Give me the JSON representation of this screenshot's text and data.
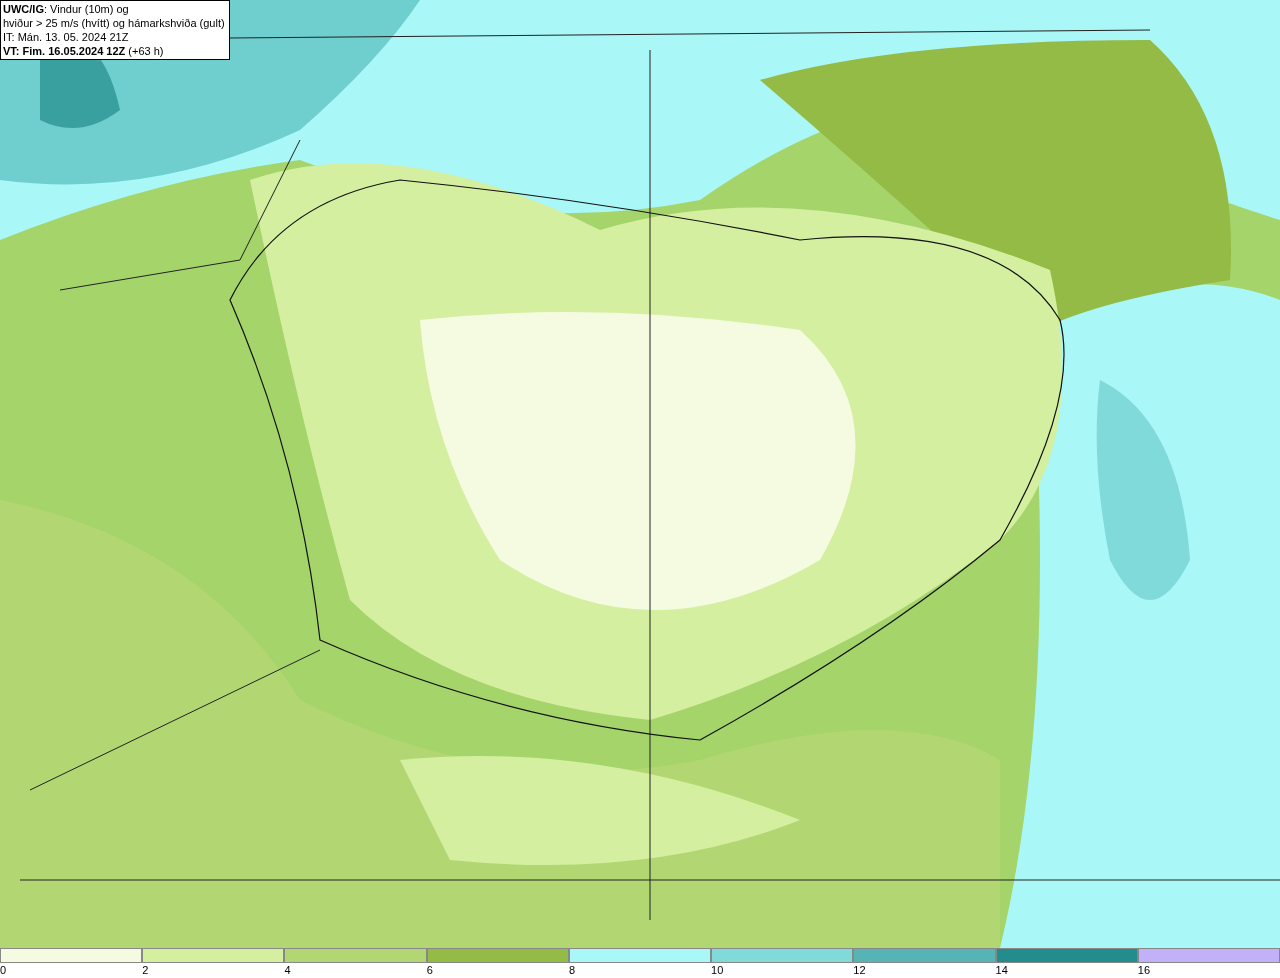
{
  "info_box": {
    "lines": [
      "**UWC/IG**: Vindur (10m) og",
      "hviður > 25 m/s (hvítt) og hámarkshviða (gult)",
      "IT: Mán. 13. 05. 2024 21Z",
      "**VT: Fim. 16.05.2024 12Z** (+63 h)"
    ]
  },
  "legend": {
    "bins": [
      {
        "label": "0",
        "color": "#f5fbe0"
      },
      {
        "label": "2",
        "color": "#d4ef9f"
      },
      {
        "label": "4",
        "color": "#b2d772"
      },
      {
        "label": "6",
        "color": "#93bb45"
      },
      {
        "label": "8",
        "color": "#aaf7f7"
      },
      {
        "label": "10",
        "color": "#80dada"
      },
      {
        "label": "12",
        "color": "#56b4b4"
      },
      {
        "label": "14",
        "color": "#238c8c"
      },
      {
        "label": "16",
        "color": "#c2b0f8"
      }
    ]
  }
}
